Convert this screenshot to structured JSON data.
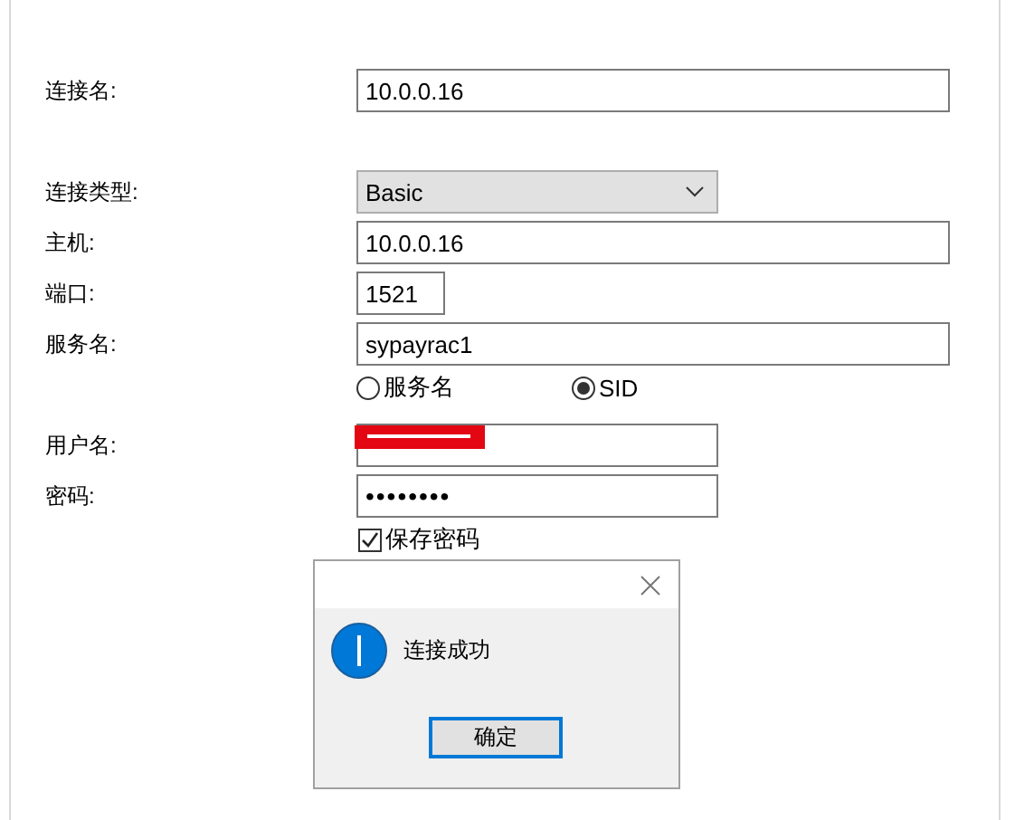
{
  "form": {
    "fields": [
      {
        "label": "连接名:",
        "kind": "text",
        "value": "10.0.0.16"
      },
      {
        "label": "连接类型:",
        "kind": "select",
        "value": "Basic"
      },
      {
        "label": "主机:",
        "kind": "text",
        "value": "10.0.0.16"
      },
      {
        "label": "端口:",
        "kind": "short",
        "value": "1521"
      },
      {
        "label": "服务名:",
        "kind": "text",
        "value": "sypayrac1"
      },
      {
        "kind": "radio",
        "options": [
          {
            "label": "服务名",
            "selected": false
          },
          {
            "label": "SID",
            "selected": true
          }
        ]
      },
      {
        "label": "用户名:",
        "kind": "redacted"
      },
      {
        "label": "密码:",
        "kind": "password",
        "value": "••••••••"
      },
      {
        "kind": "checkbox",
        "label": "保存密码",
        "checked": true
      }
    ]
  },
  "dialog": {
    "message": "连接成功",
    "button": "确定"
  }
}
